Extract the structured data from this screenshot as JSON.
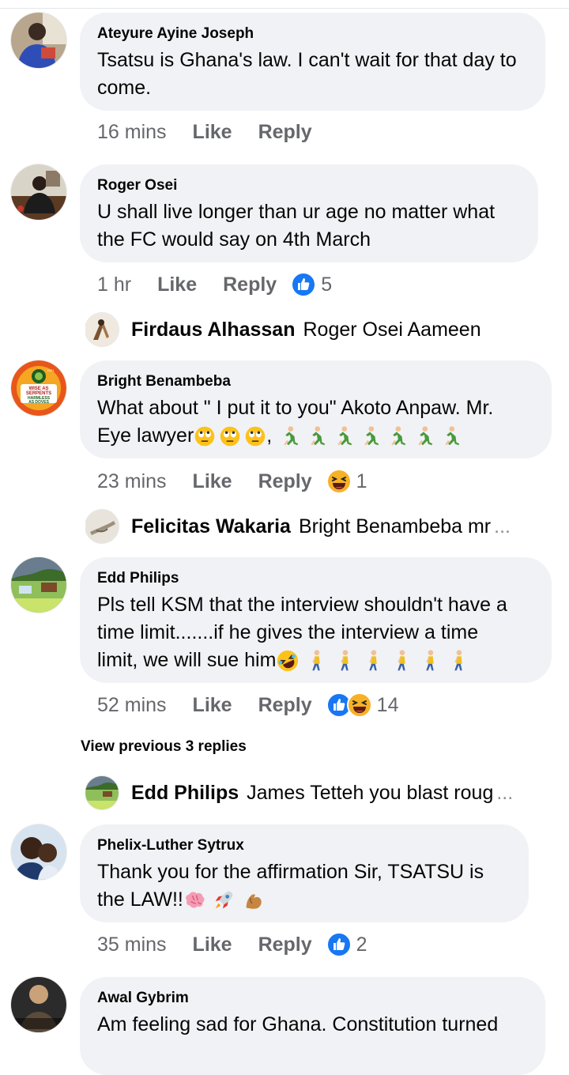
{
  "comments": [
    {
      "author": "Ateyure Ayine Joseph",
      "text": "Tsatsu is Ghana's law. I can't wait for that day to come.",
      "time": "16 mins",
      "like": "Like",
      "reply": "Reply"
    },
    {
      "author": "Roger Osei",
      "text": "U shall live longer than ur age no matter what the FC would say on 4th March",
      "time": "1 hr",
      "like": "Like",
      "reply": "Reply",
      "reaction_count": "5",
      "reactions": [
        "like-reaction-icon"
      ]
    },
    {
      "author": "Bright Benambeba",
      "text_line1": "What about \" I put it  to you\"  Akoto Anpaw. Mr.",
      "text_line2": "Eye lawyer",
      "emoji_after": [
        "eye-roll-emoji",
        "eye-roll-emoji",
        "eye-roll-emoji",
        "runner-emoji x7"
      ],
      "time": "23 mins",
      "like": "Like",
      "reply": "Reply",
      "reaction_count": "1",
      "reactions": [
        "haha-reaction-icon"
      ]
    },
    {
      "author": "Edd Philips",
      "text_line1": "Pls tell KSM that the interview shouldn't have a",
      "text_line2": "time limit.......if he gives the interview a time",
      "text_line3": "limit, we will sue him",
      "time": "52 mins",
      "like": "Like",
      "reply": "Reply",
      "reaction_count": "14",
      "reactions": [
        "like-reaction-icon",
        "haha-reaction-icon"
      ]
    },
    {
      "author": "Phelix-Luther Sytrux",
      "text_line1": "Thank you for the affirmation Sir, TSATSU is",
      "text_line2": "the LAW!!",
      "time": "35 mins",
      "like": "Like",
      "reply": "Reply",
      "reaction_count": "2",
      "reactions": [
        "like-reaction-icon"
      ]
    },
    {
      "author": "Awal Gybrim",
      "text": "Am feeling sad for Ghana. Constitution turned"
    }
  ],
  "replies": [
    {
      "author": "Firdaus Alhassan",
      "text": "Roger Osei Aameen"
    },
    {
      "author": "Felicitas Wakaria",
      "text": "Bright Benambeba mr",
      "truncated": "..."
    },
    {
      "author": "Edd Philips",
      "text": "James Tetteh you blast roug",
      "truncated": "..."
    }
  ],
  "view_previous": "View previous 3 replies",
  "avatar_badge": {
    "line1": "WISE AS",
    "line2": "SERPENTS",
    "line3": "HARMLESS",
    "line4": "AS DOVES",
    "year": "2021"
  },
  "colors": {
    "bubble": "#f0f2f5",
    "meta": "#65676b",
    "like_blue": "#1877f2",
    "haha_yellow": "#f7b125"
  }
}
